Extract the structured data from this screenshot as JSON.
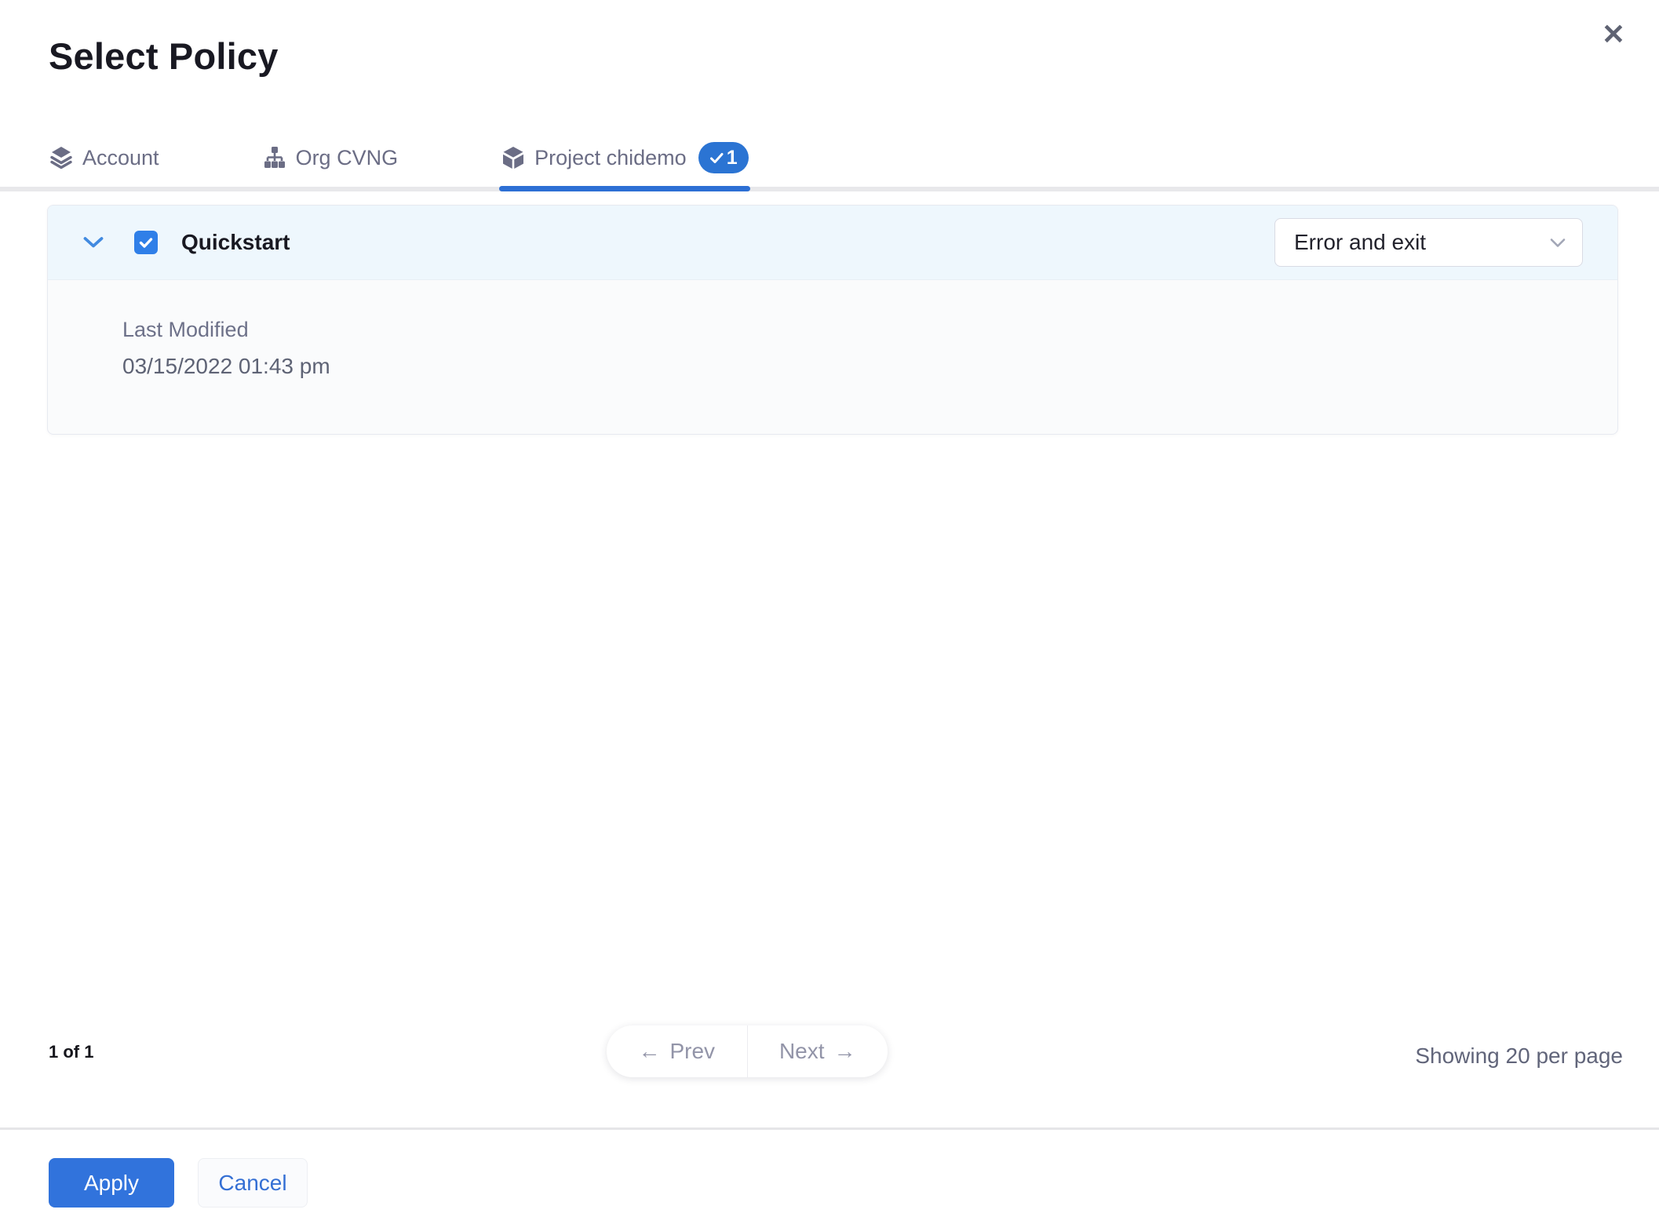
{
  "modal": {
    "title": "Select Policy"
  },
  "tabs": {
    "items": [
      {
        "id": "account",
        "label": "Account",
        "icon": "layers-icon",
        "selected": false
      },
      {
        "id": "org",
        "label": "Org CVNG",
        "icon": "org-hierarchy-icon",
        "selected": false
      },
      {
        "id": "project",
        "label": "Project chidemo",
        "icon": "cube-icon",
        "selected": true,
        "badge_count": "1"
      }
    ]
  },
  "policies": [
    {
      "name": "Quickstart",
      "checked": true,
      "expanded": true,
      "action": "Error and exit",
      "details": [
        {
          "label": "Last Modified",
          "value": "03/15/2022 01:43 pm"
        }
      ]
    }
  ],
  "pagination": {
    "page_info": "1 of 1",
    "prev": "Prev",
    "next": "Next",
    "showing": "Showing 20 per page"
  },
  "footer": {
    "apply": "Apply",
    "cancel": "Cancel"
  },
  "icons": {
    "close": "✕",
    "prev_arrow": "←",
    "next_arrow": "→",
    "badge_check": "check-icon",
    "checkbox_check": "check-icon",
    "row_expand": "chevron-down-icon",
    "select_caret": "chevron-down-icon"
  },
  "colors": {
    "accent_blue": "#3173dc",
    "badge_blue": "#2b74d3",
    "checkbox_blue": "#2f7fe8",
    "tab_underline_blue": "#2d6fd4",
    "row_header_bg": "#eef7fd",
    "card_body_bg": "#fafbfc",
    "slate_text": "#6b6d85",
    "muted_text": "#9294a8"
  }
}
